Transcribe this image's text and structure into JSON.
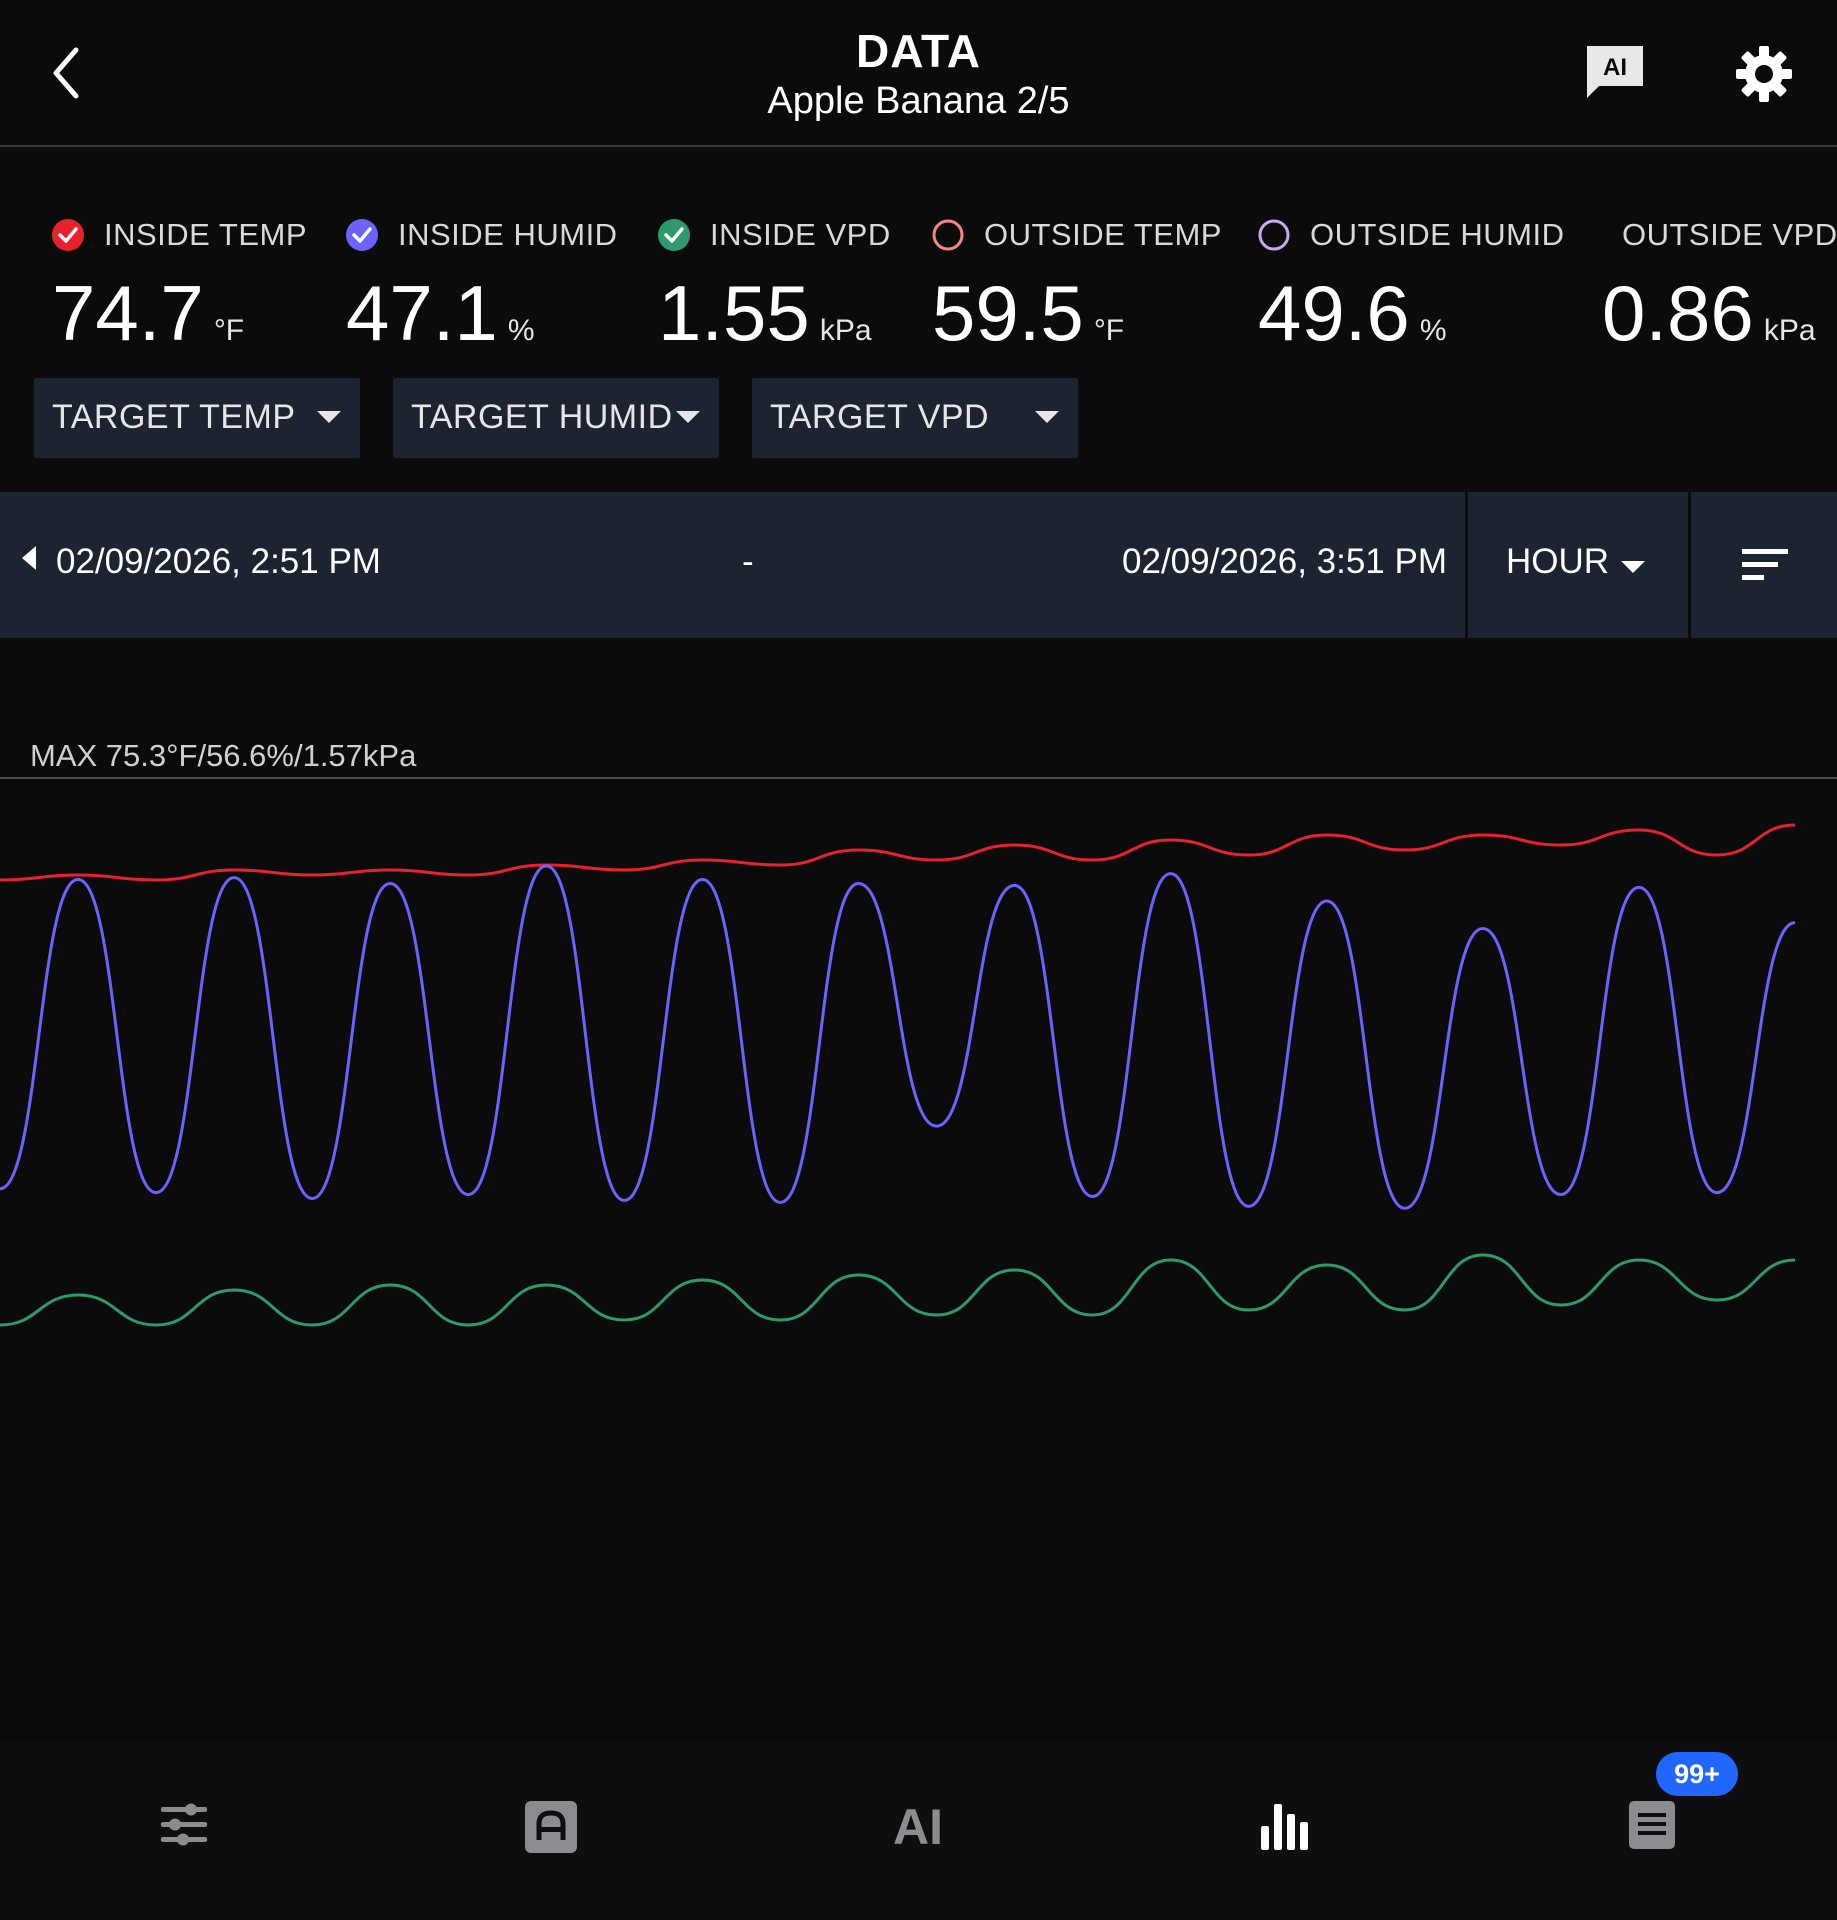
{
  "header": {
    "title": "DATA",
    "subtitle": "Apple Banana 2/5",
    "ai_badge_text": "AI"
  },
  "metrics": [
    {
      "label": "INSIDE TEMP",
      "value": "74.7",
      "unit": "°F",
      "color": "#e8212e",
      "checked": true
    },
    {
      "label": "INSIDE HUMID",
      "value": "47.1",
      "unit": "%",
      "color": "#6c63ff",
      "checked": true
    },
    {
      "label": "INSIDE VPD",
      "value": "1.55",
      "unit": "kPa",
      "color": "#2e9a6a",
      "checked": true
    },
    {
      "label": "OUTSIDE TEMP",
      "value": "59.5",
      "unit": "°F",
      "color": "#f08a80",
      "checked": false
    },
    {
      "label": "OUTSIDE HUMID",
      "value": "49.6",
      "unit": "%",
      "color": "#c8a8f0",
      "checked": false
    },
    {
      "label": "OUTSIDE VPD",
      "value": "0.86",
      "unit": "kPa",
      "color": "#2bb5b5",
      "checked": false
    }
  ],
  "targets": [
    "TARGET TEMP",
    "TARGET HUMID",
    "TARGET VPD"
  ],
  "range": {
    "start": "02/09/2026, 2:51 PM",
    "separator": "-",
    "end": "02/09/2026, 3:51 PM",
    "period": "HOUR"
  },
  "chart_max_label": "MAX 75.3°F/56.6%/1.57kPa",
  "chart_data": {
    "type": "line",
    "title": "",
    "xlabel": "",
    "ylabel": "",
    "xlim": [
      "02/09/2026, 2:51 PM",
      "02/09/2026, 3:51 PM"
    ],
    "grid": false,
    "max_label": "MAX 75.3°F/56.6%/1.57kPa",
    "series": [
      {
        "name": "INSIDE TEMP",
        "color": "#e8212e",
        "unit": "°F",
        "peaks": [
          74.3,
          74.4,
          74.4,
          74.5,
          74.6,
          74.8,
          74.9,
          75.0,
          75.1,
          75.1,
          75.2,
          75.3
        ],
        "troughs": [
          74.2,
          74.2,
          74.3,
          74.3,
          74.4,
          74.5,
          74.6,
          74.6,
          74.7,
          74.8,
          74.9,
          74.7
        ]
      },
      {
        "name": "INSIDE HUMID",
        "color": "#6c63ff",
        "unit": "%",
        "peaks": [
          55.9,
          56.0,
          55.7,
          56.6,
          55.9,
          55.7,
          55.6,
          56.2,
          54.8,
          53.4,
          55.5,
          53.7
        ],
        "troughs": [
          40.1,
          39.9,
          39.6,
          39.8,
          39.5,
          39.4,
          43.3,
          39.7,
          39.2,
          39.1,
          39.8,
          39.9
        ]
      },
      {
        "name": "INSIDE VPD",
        "color": "#2e9a6a",
        "unit": "kPa",
        "peaks": [
          1.49,
          1.5,
          1.51,
          1.51,
          1.52,
          1.53,
          1.54,
          1.56,
          1.55,
          1.57,
          1.56,
          1.56
        ],
        "troughs": [
          1.43,
          1.43,
          1.43,
          1.43,
          1.44,
          1.44,
          1.45,
          1.45,
          1.46,
          1.46,
          1.47,
          1.48
        ]
      }
    ]
  },
  "nav": [
    {
      "name": "controls",
      "icon": "sliders-icon"
    },
    {
      "name": "device",
      "icon": "device-icon"
    },
    {
      "name": "ai",
      "icon": "ai-logo-icon",
      "text": "AI"
    },
    {
      "name": "data",
      "icon": "bar-chart-icon"
    },
    {
      "name": "logs",
      "icon": "list-doc-icon"
    }
  ],
  "badge": "99+"
}
